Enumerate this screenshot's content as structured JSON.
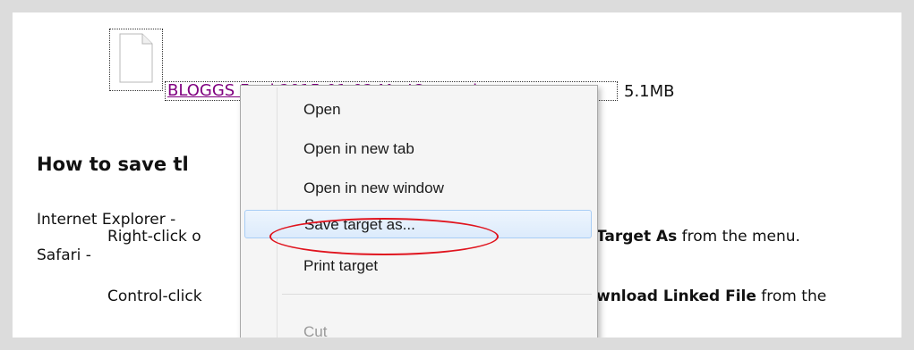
{
  "file": {
    "name": "BLOGGS Fred 2015-01-02 Mn JComp sim",
    "size": "5.1MB",
    "icon": "file-icon"
  },
  "heading": "How to save tl",
  "instructions": {
    "ie_label": "Internet Explorer -",
    "ie_text_left": "Right-click o",
    "ie_text_right_bold": "Target As",
    "ie_text_right": " from the menu.",
    "safari_label": "Safari -",
    "safari_text_left": "Control-click",
    "safari_text_right_bold": "wnload Linked File",
    "safari_text_right": " from the"
  },
  "context_menu": {
    "items": [
      {
        "label": "Open"
      },
      {
        "label": "Open in new tab"
      },
      {
        "label": "Open in new window"
      },
      {
        "label": "Save target as..."
      },
      {
        "label": "Print target"
      },
      {
        "label": "Cut"
      }
    ],
    "highlight_color": "#e0141e"
  }
}
